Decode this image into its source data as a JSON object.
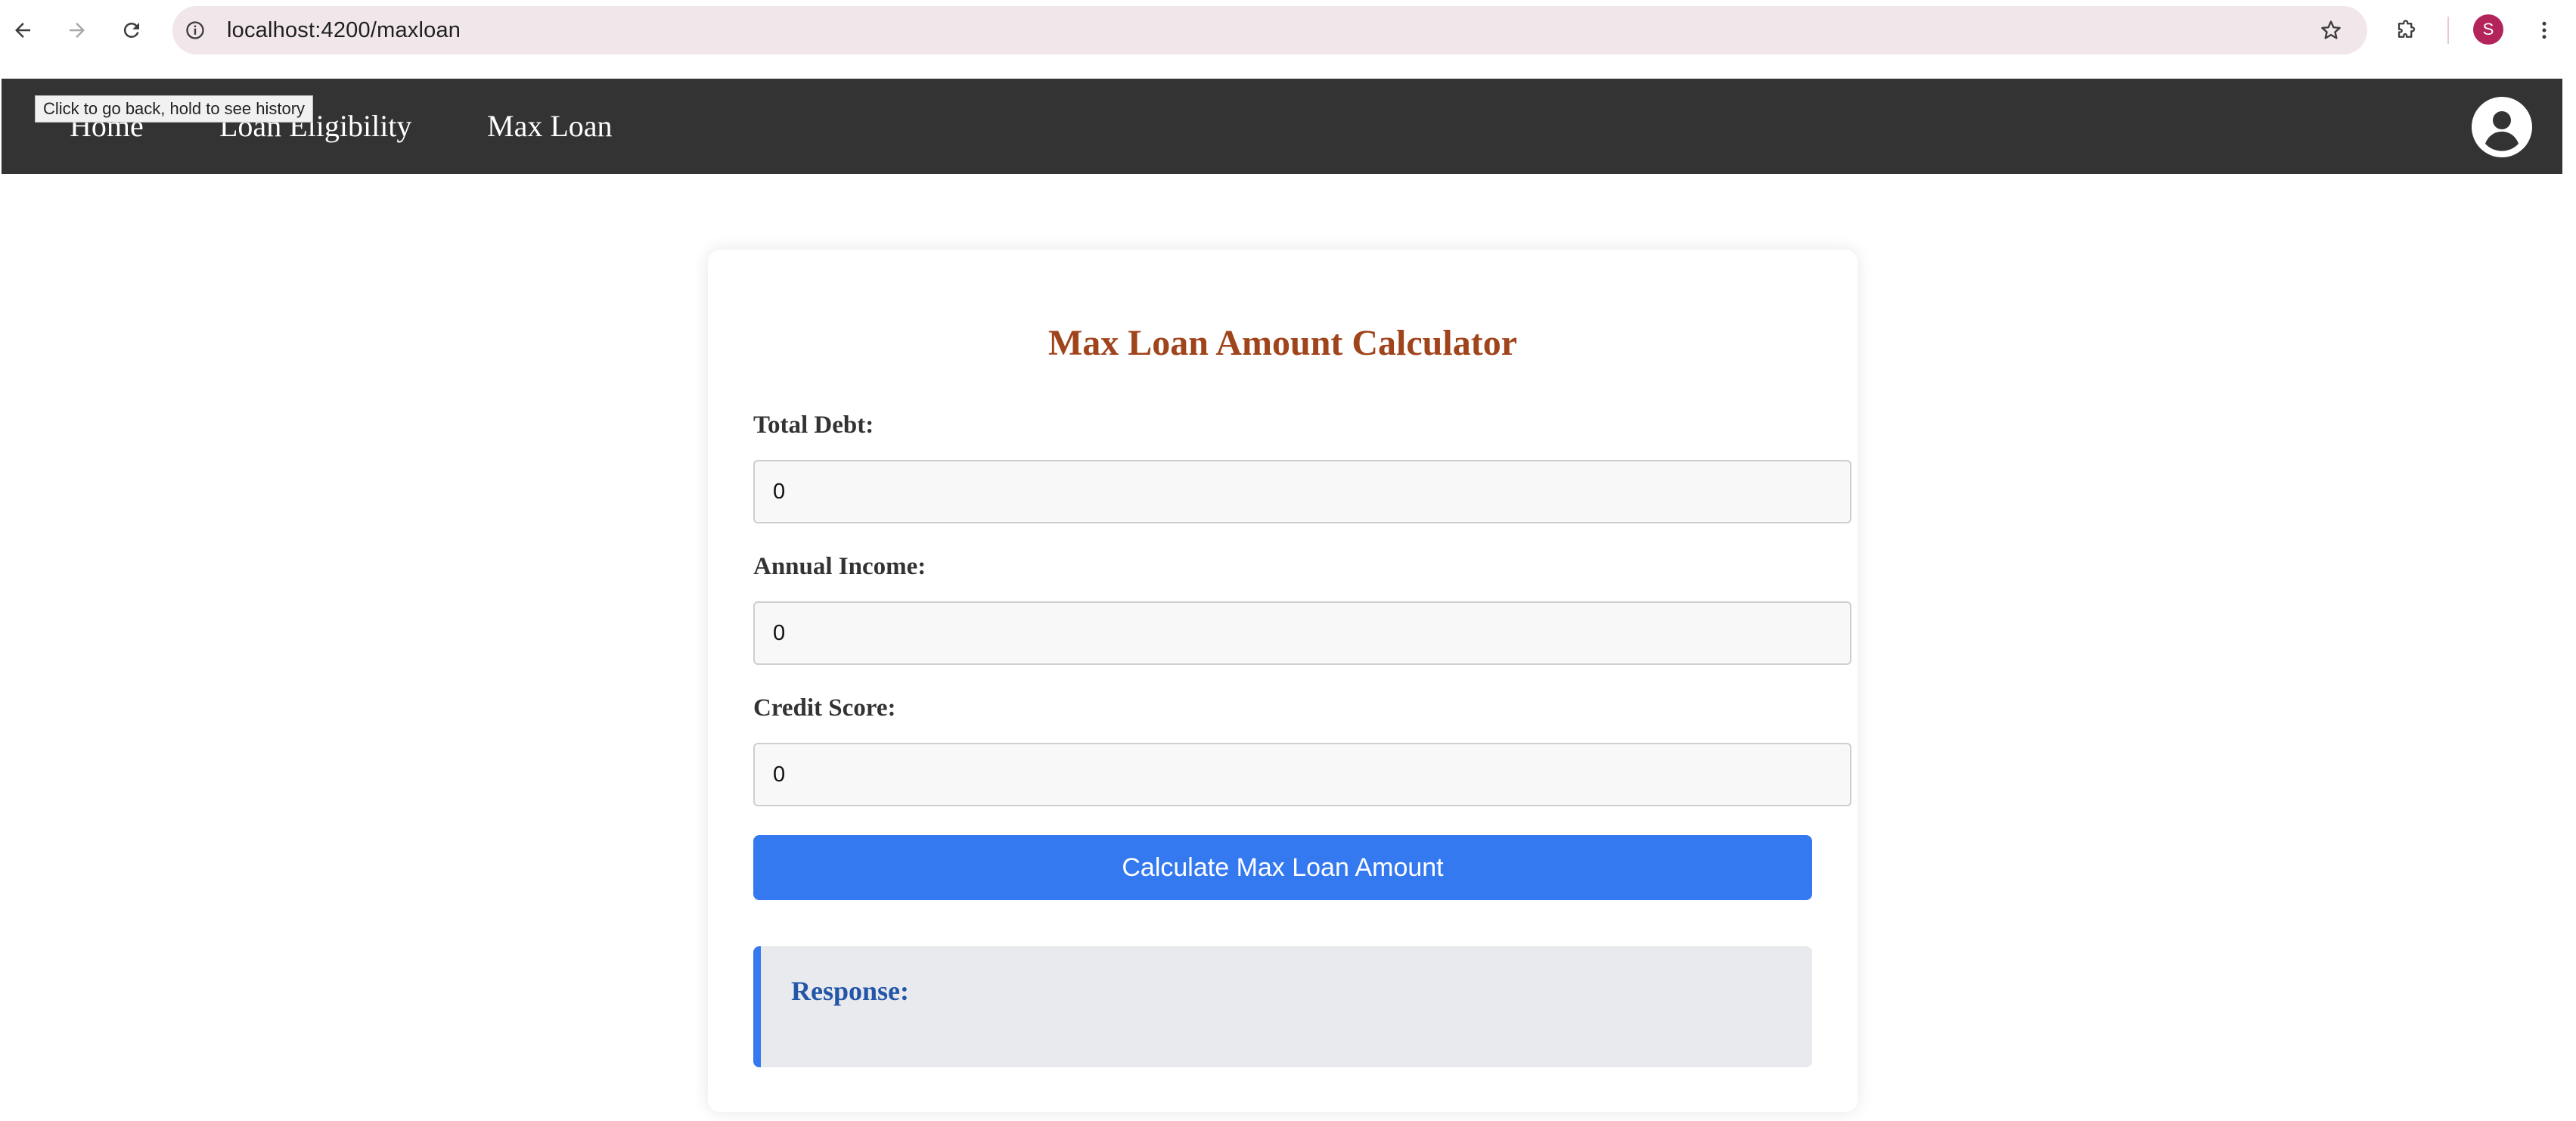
{
  "browser": {
    "url": "localhost:4200/maxloan",
    "profile_initial": "S",
    "tooltip": "Click to go back, hold to see history",
    "icons": {
      "back": "arrow-left-icon",
      "forward": "arrow-right-icon",
      "reload": "reload-icon",
      "site_info": "info-icon",
      "bookmark": "star-icon",
      "extensions": "puzzle-icon",
      "menu": "kebab-menu-icon"
    }
  },
  "navbar": {
    "items": [
      {
        "label": "Home"
      },
      {
        "label": "Loan Eligibility"
      },
      {
        "label": "Max Loan"
      }
    ],
    "user_icon": "account-circle-icon"
  },
  "calculator": {
    "title": "Max Loan Amount Calculator",
    "fields": {
      "total_debt": {
        "label": "Total Debt:",
        "value": "0"
      },
      "annual_income": {
        "label": "Annual Income:",
        "value": "0"
      },
      "credit_score": {
        "label": "Credit Score:",
        "value": "0"
      }
    },
    "submit_label": "Calculate Max Loan Amount",
    "response": {
      "title": "Response:",
      "value": ""
    }
  },
  "colors": {
    "navbar_bg": "#333333",
    "title": "#a0441c",
    "button": "#3479f0",
    "response_title": "#2456a8",
    "response_bg": "#e9eaee",
    "omnibox_bg": "#f1e6ea",
    "profile_badge": "#b3245c"
  }
}
